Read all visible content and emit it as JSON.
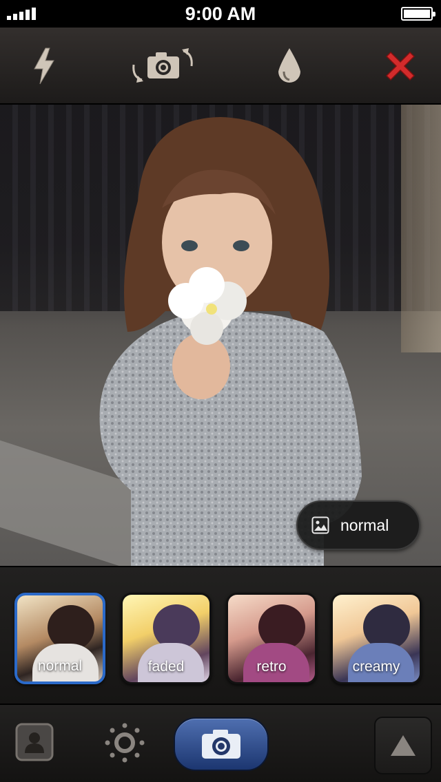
{
  "status_bar": {
    "time": "9:00 AM",
    "signal_bars": 5,
    "battery_level": 1.0
  },
  "top_bar": {
    "icons": [
      "flash-icon",
      "switch-camera-icon",
      "drop-icon",
      "close-icon"
    ],
    "colors": {
      "icon": "#cfc5b8",
      "close": "#d22b2b"
    }
  },
  "preview": {
    "filter_badge_label": "normal"
  },
  "filters": [
    {
      "label": "normal",
      "selected": true
    },
    {
      "label": "faded",
      "selected": false
    },
    {
      "label": "retro",
      "selected": false
    },
    {
      "label": "creamy",
      "selected": false
    }
  ],
  "bottom_bar": {
    "icons": [
      "profile-icon",
      "brightness-icon",
      "camera-shutter-icon",
      "triangle-up-icon"
    ],
    "colors": {
      "shutter": "#2f4f93",
      "icon": "#8a8580"
    }
  }
}
